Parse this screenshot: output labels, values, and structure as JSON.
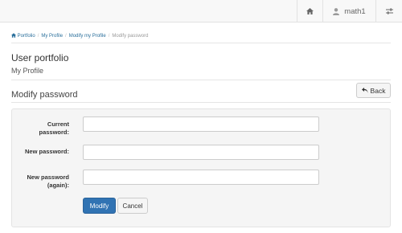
{
  "navbar": {
    "home_icon": "home-icon",
    "user_icon": "user-icon",
    "user_name": "math1",
    "settings_icon": "sliders-icon"
  },
  "breadcrumb": {
    "items": [
      "Portfolio",
      "My Profile",
      "Modify my Profile",
      "Modify password"
    ]
  },
  "page": {
    "title": "User portfolio",
    "subtitle": "My Profile",
    "section_title": "Modify password"
  },
  "back_button": {
    "label": "Back",
    "icon": "back-arrow-icon"
  },
  "form": {
    "current_password_label_1": "Current",
    "current_password_label_2": "password:",
    "new_password_label": "New password:",
    "new_password_again_label_1": "New password",
    "new_password_again_label_2": "(again):",
    "current_password_value": "",
    "new_password_value": "",
    "new_password_again_value": "",
    "modify_label": "Modify",
    "cancel_label": "Cancel"
  },
  "colors": {
    "primary": "#3173b3",
    "link": "#2a6f9b",
    "navbar_bg": "#f8f8f8",
    "panel_bg": "#f5f5f5"
  }
}
